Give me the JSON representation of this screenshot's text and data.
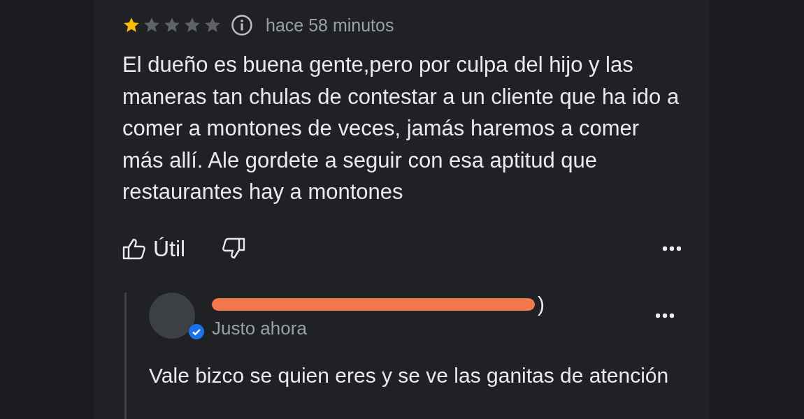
{
  "review": {
    "stars": 1,
    "time": "hace 58 minutos",
    "text": "El dueño es buena gente,pero por culpa del hijo y las maneras tan chulas de contestar a un cliente que ha ido a comer a montones de veces, jamás haremos a comer más allí. Ale gordete a seguir con esa aptitud que restaurantes hay a montones",
    "helpful_label": "Útil"
  },
  "reply": {
    "owner_name": ")",
    "redacted": true,
    "verified": true,
    "time": "Justo ahora",
    "text": "Vale bizco se quien eres y se ve las ganitas de atención"
  }
}
